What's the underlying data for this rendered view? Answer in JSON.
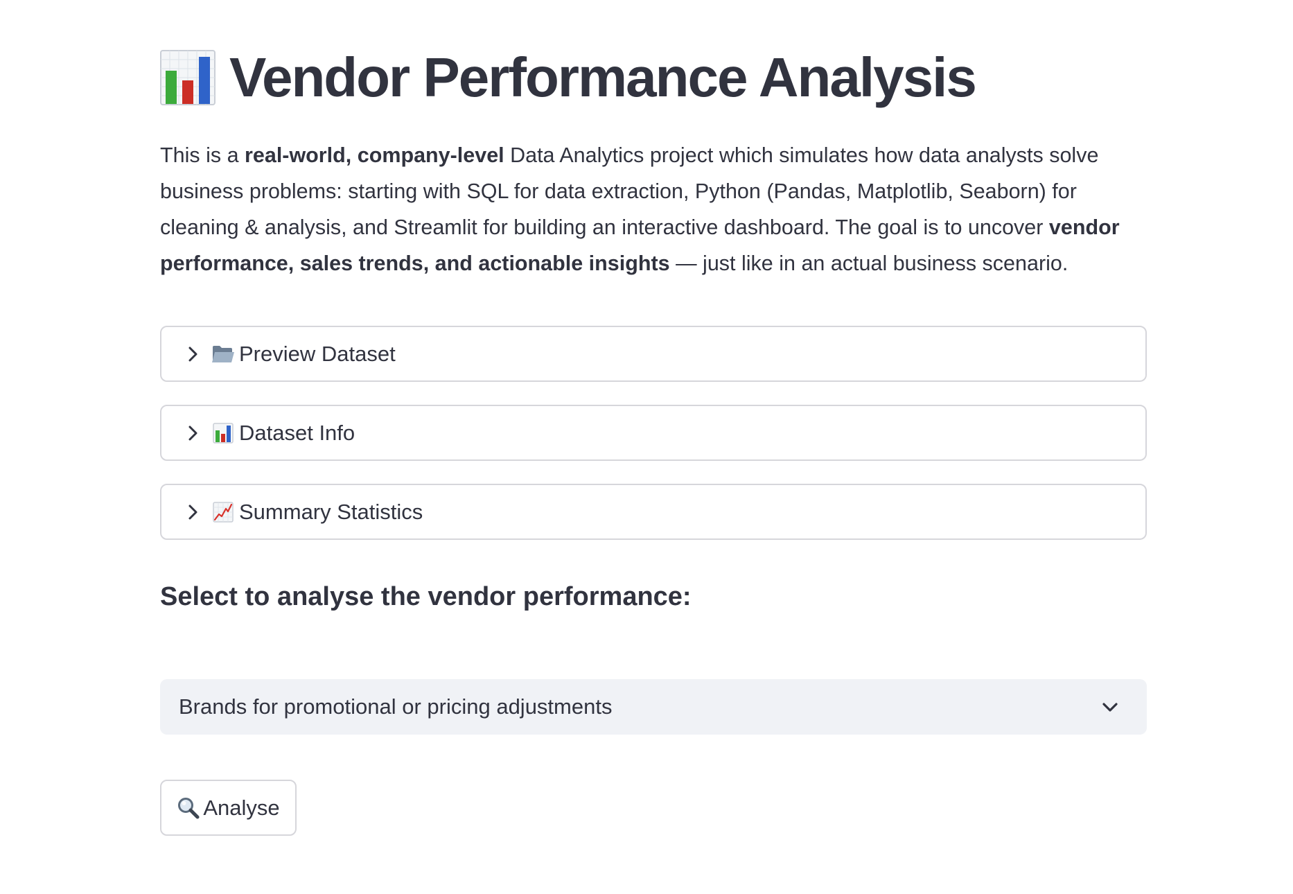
{
  "header": {
    "title": "Vendor Performance Analysis",
    "title_icon": "bar-chart-icon"
  },
  "intro": {
    "part1": "This is a ",
    "bold1": "real-world, company-level",
    "part2": " Data Analytics project which simulates how data analysts solve business problems: starting with SQL for data extraction, Python (Pandas, Matplotlib, Seaborn) for cleaning & analysis, and Streamlit for building an interactive dashboard. The goal is to uncover ",
    "bold2": "vendor performance, sales trends, and actionable insights",
    "part3": " — just like in an actual business scenario."
  },
  "expanders": [
    {
      "label": "Preview Dataset",
      "icon": "folder-icon"
    },
    {
      "label": "Dataset Info",
      "icon": "bar-chart-icon"
    },
    {
      "label": "Summary Statistics",
      "icon": "line-chart-icon"
    }
  ],
  "section": {
    "subheader": "Select to analyse the vendor performance:"
  },
  "select": {
    "value": "Brands for promotional or pricing adjustments"
  },
  "button": {
    "label": "Analyse",
    "icon": "magnifier-icon"
  },
  "colors": {
    "text": "#31333f",
    "border": "#d6d6db",
    "select_bg": "#f0f2f6"
  }
}
